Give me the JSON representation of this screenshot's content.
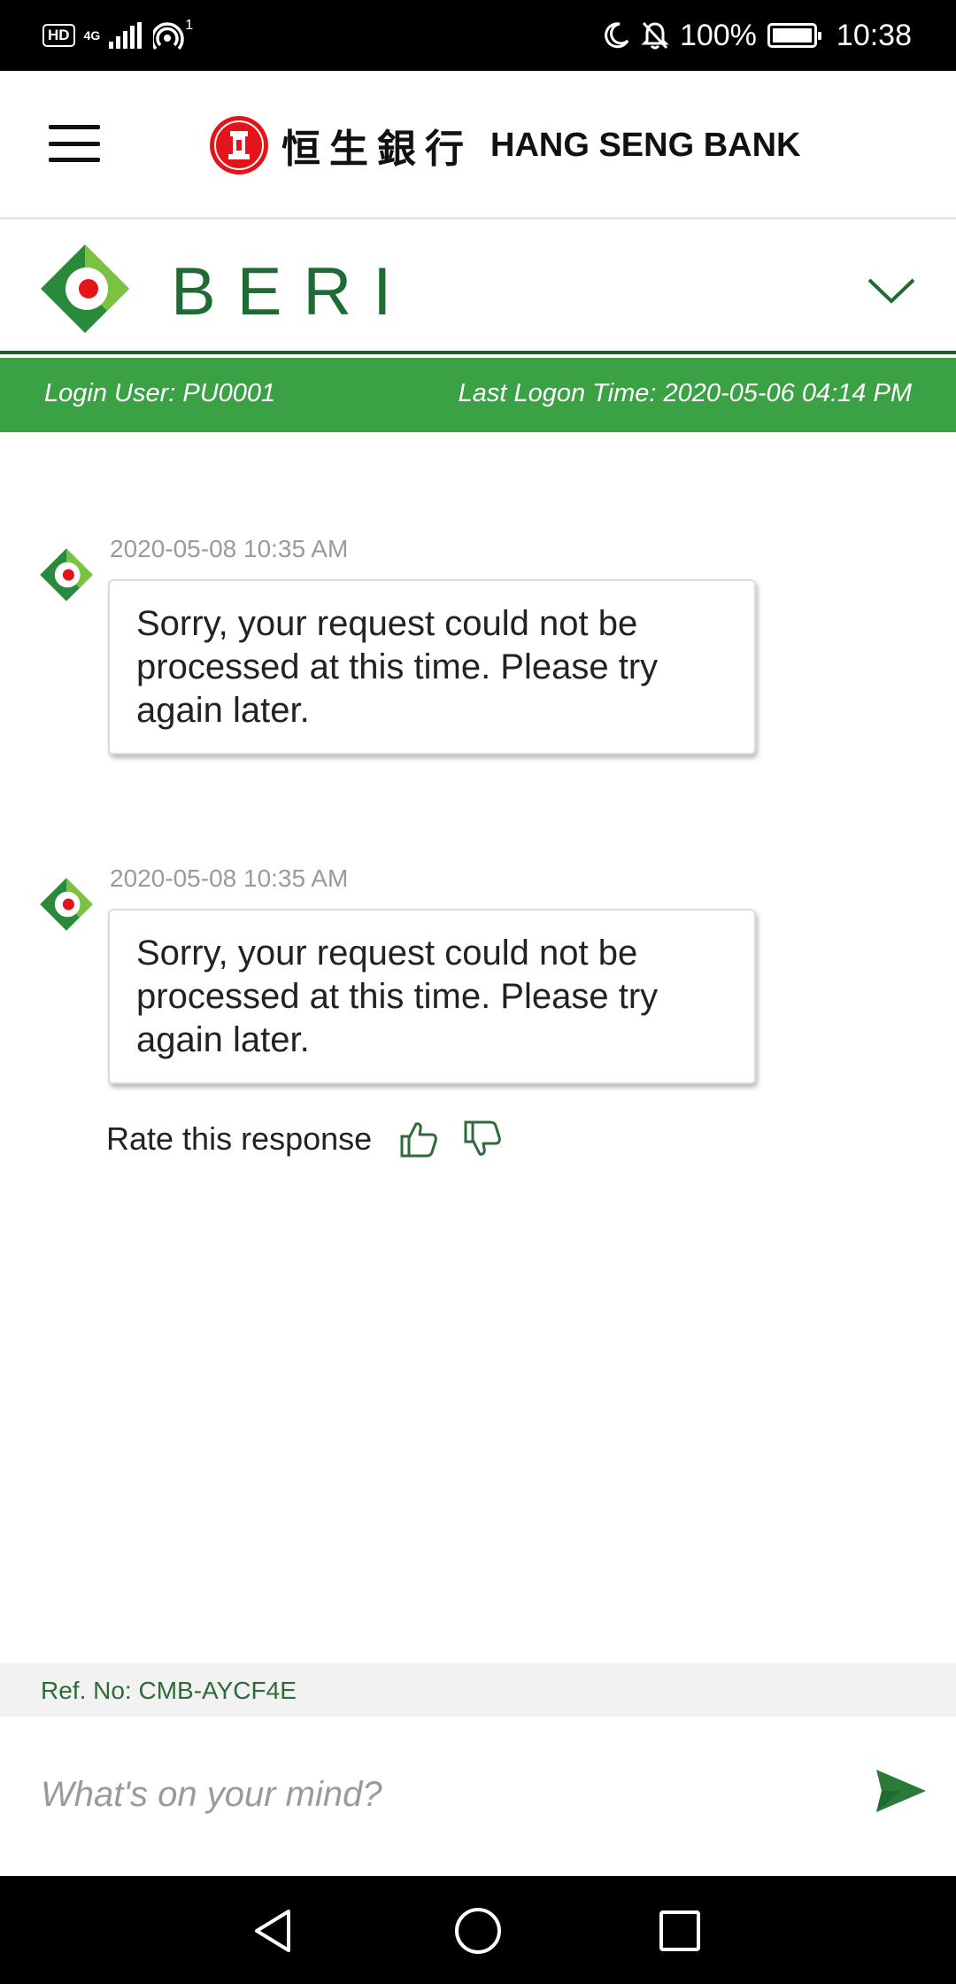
{
  "status_bar": {
    "hd_label": "HD",
    "network_label": "4G",
    "hotspot_count": "1",
    "battery": "100%",
    "time": "10:38"
  },
  "header": {
    "bank_name_cn": "恒生銀行",
    "bank_name_en": "HANG SENG BANK",
    "menu_icon": "hamburger-menu-icon",
    "brand_color": "#e3151b"
  },
  "beri": {
    "title": "BERI",
    "chevron_icon": "chevron-down-icon",
    "brand_green": "#1f6b34"
  },
  "login": {
    "user": "Login User: PU0001",
    "last_logon": "Last Logon Time: 2020-05-06 04:14 PM",
    "bar_color": "#3aa145"
  },
  "messages": [
    {
      "timestamp": "2020-05-08 10:35 AM",
      "text": "Sorry, your request could not be processed at this time. Please try again later."
    },
    {
      "timestamp": "2020-05-08 10:35 AM",
      "text": "Sorry, your request could not be processed at this time. Please try again later."
    }
  ],
  "rating": {
    "label": "Rate this response",
    "thumbs_up_icon": "thumbs-up-icon",
    "thumbs_down_icon": "thumbs-down-icon"
  },
  "ref": {
    "text": "Ref. No: CMB-AYCF4E"
  },
  "input": {
    "placeholder": "What's on your mind?",
    "value": "",
    "send_icon": "send-icon"
  },
  "nav": {
    "back_icon": "back-triangle-icon",
    "home_icon": "home-circle-icon",
    "recents_icon": "recents-square-icon"
  }
}
